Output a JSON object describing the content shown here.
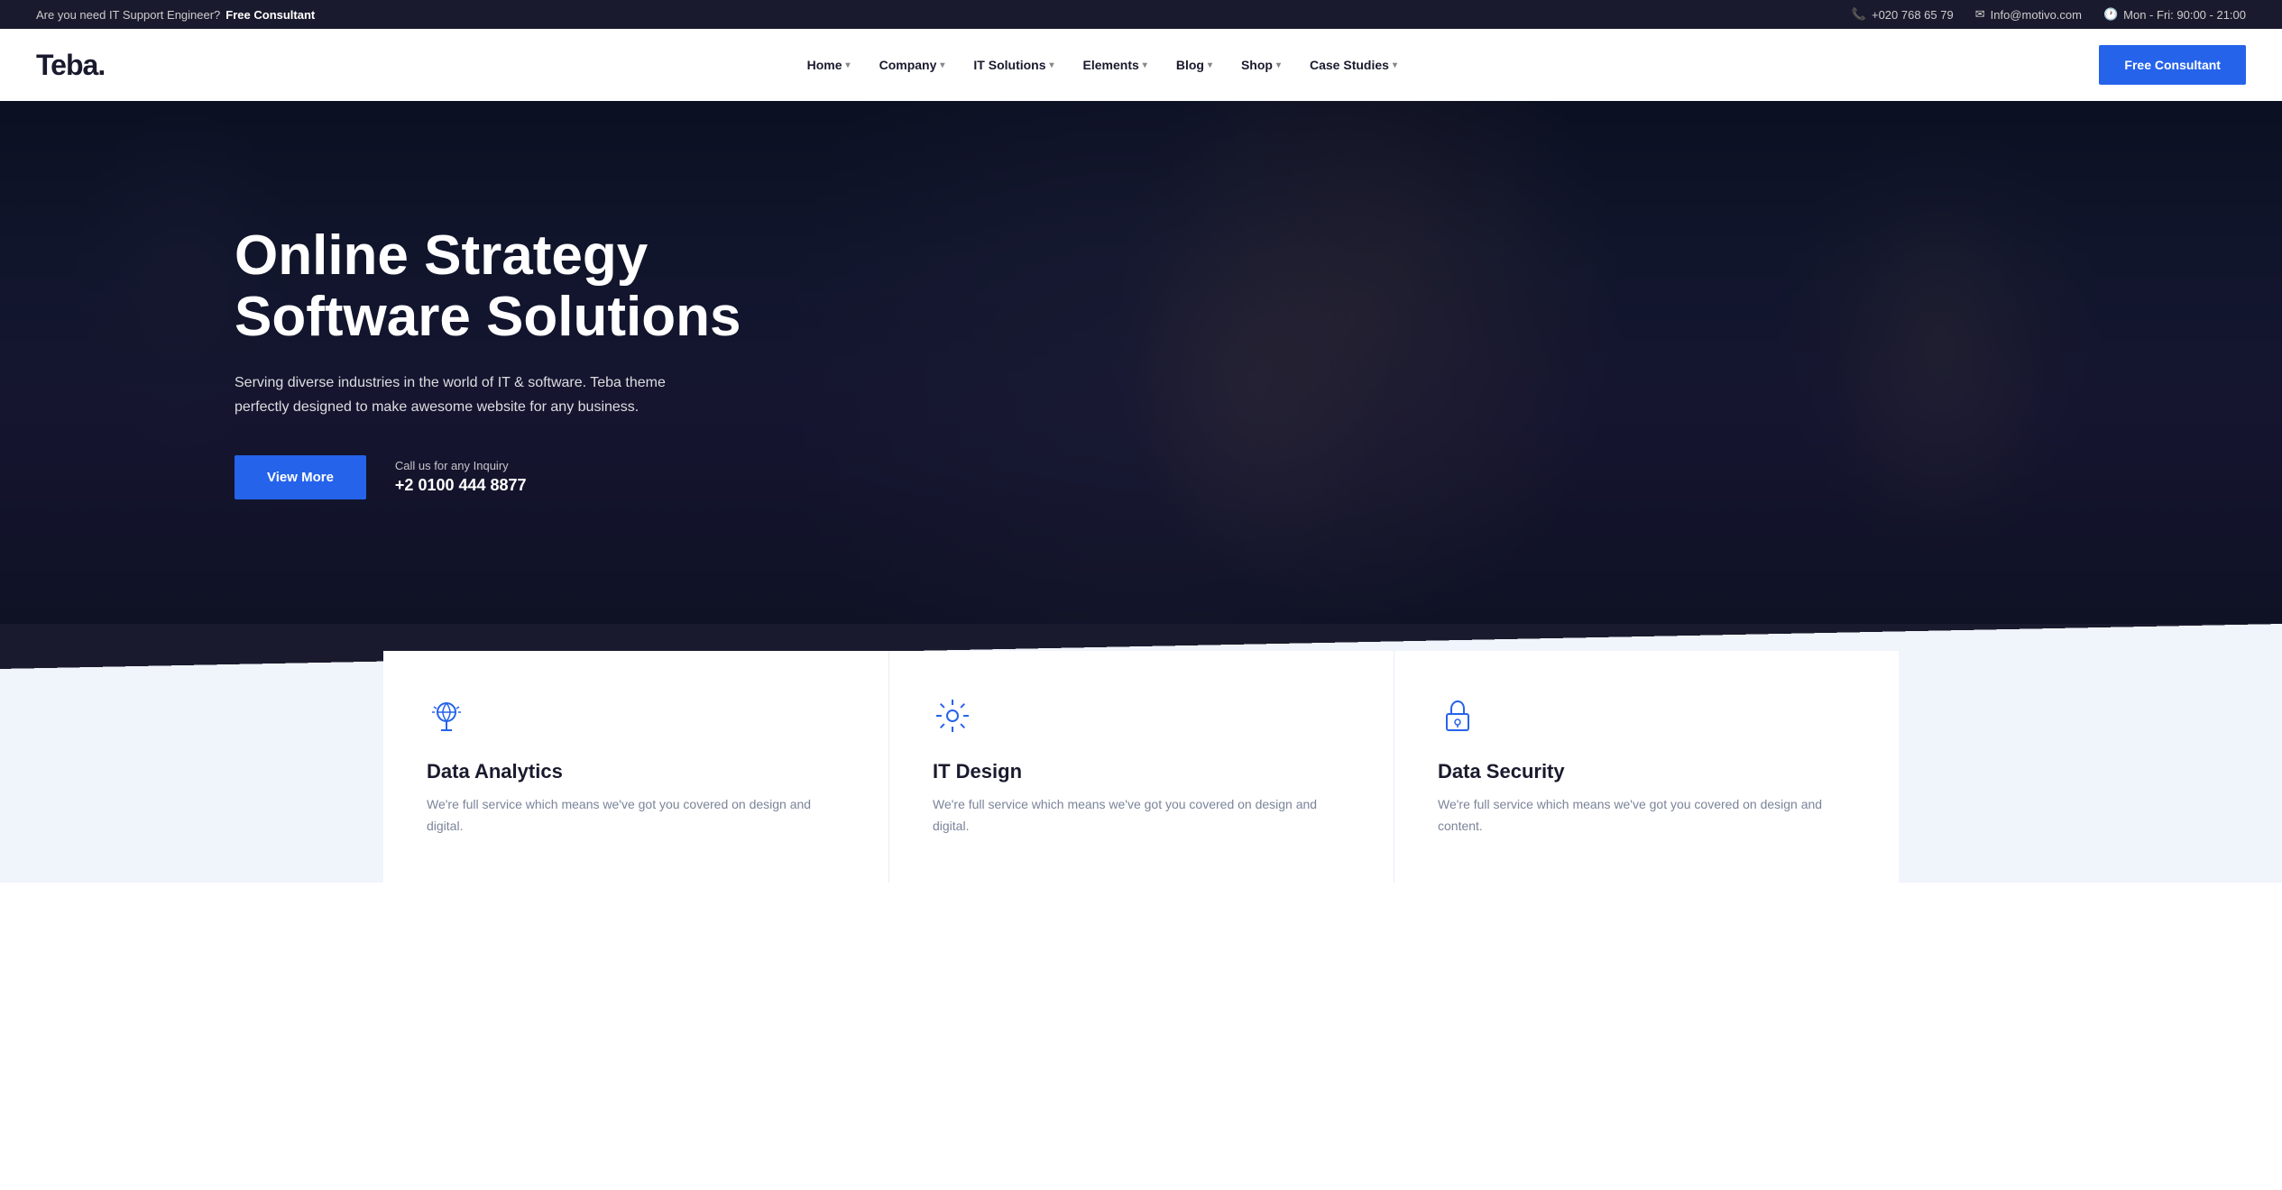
{
  "topbar": {
    "promo_text": "Are you need IT Support Engineer?",
    "promo_cta": "Free Consultant",
    "phone": "+020 768 65 79",
    "email": "Info@motivo.com",
    "hours": "Mon - Fri: 90:00 - 21:00"
  },
  "header": {
    "logo": "Teba.",
    "nav": [
      {
        "label": "Home",
        "has_dropdown": true
      },
      {
        "label": "Company",
        "has_dropdown": true
      },
      {
        "label": "IT Solutions",
        "has_dropdown": true
      },
      {
        "label": "Elements",
        "has_dropdown": true
      },
      {
        "label": "Blog",
        "has_dropdown": true
      },
      {
        "label": "Shop",
        "has_dropdown": true
      },
      {
        "label": "Case Studies",
        "has_dropdown": true
      }
    ],
    "cta_button": "Free Consultant"
  },
  "hero": {
    "title_line1": "Online Strategy",
    "title_line2": "Software Solutions",
    "subtitle": "Serving diverse industries in the world of IT & software. Teba theme perfectly designed to make awesome website for any business.",
    "view_more_label": "View More",
    "call_label": "Call us for any Inquiry",
    "call_number": "+2 0100 444 8877"
  },
  "features": [
    {
      "icon": "bulb",
      "title": "Data Analytics",
      "description": "We're full service which means we've got you covered on design and digital."
    },
    {
      "icon": "gear",
      "title": "IT Design",
      "description": "We're full service which means we've got you covered on design and digital."
    },
    {
      "icon": "lock",
      "title": "Data Security",
      "description": "We're full service which means we've got you covered on design and content."
    }
  ]
}
